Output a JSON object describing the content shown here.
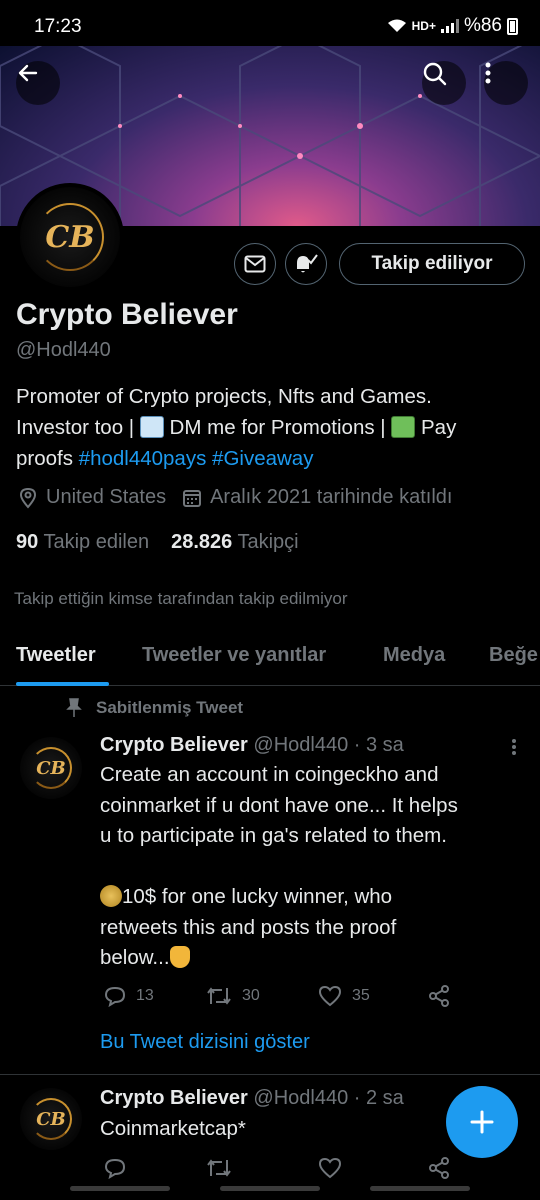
{
  "status_bar": {
    "time": "17:23",
    "network": "HD+",
    "battery": "%86"
  },
  "profile": {
    "name": "Crypto Believer",
    "handle": "@Hodl440",
    "avatar_monogram": "CB",
    "follow_button": "Takip ediliyor",
    "bio_line1": "Promoter of Crypto projects, Nfts and Games.",
    "bio_line2_a": "Investor too | ",
    "bio_line2_b": " DM me for Promotions | ",
    "bio_line2_c": " Pay",
    "bio_line3_a": "proofs ",
    "hashtag1": "#hodl440pays",
    "hashtag2": "#Giveaway",
    "location": "United States",
    "joined": "Aralık 2021 tarihinde katıldı",
    "following_count": "90",
    "following_label": "Takip edilen",
    "followers_count": "28.826",
    "followers_label": "Takipçi",
    "not_followed_notice": "Takip ettiğin kimse tarafından takip edilmiyor"
  },
  "tabs": [
    {
      "label": "Tweetler",
      "active": true
    },
    {
      "label": "Tweetler ve yanıtlar",
      "active": false
    },
    {
      "label": "Medya",
      "active": false
    },
    {
      "label": "Beğe",
      "active": false
    }
  ],
  "pinned_label": "Sabitlenmiş Tweet",
  "tweets": [
    {
      "author": "Crypto Believer",
      "handle_time": "@Hodl440 · 3 sa",
      "text_lines": [
        "Create an account in coingeckho and",
        "coinmarket if u dont have one... It helps",
        "u to participate in ga's related to them.",
        "",
        "10$ for one lucky winner, who",
        "retweets this and posts the proof",
        "below..."
      ],
      "replies": "13",
      "retweets": "30",
      "likes": "35",
      "show_thread": "Bu Tweet dizisini göster"
    },
    {
      "author": "Crypto Believer",
      "handle_time": "@Hodl440 · 2 sa",
      "text": "Coinmarketcap*"
    }
  ],
  "icons": {
    "back": "arrow-left-icon",
    "search": "search-icon",
    "more": "more-vertical-icon",
    "message": "envelope-icon",
    "notify": "bell-check-icon",
    "location": "location-pin-icon",
    "calendar": "calendar-icon",
    "pin": "pin-icon",
    "reply": "reply-icon",
    "retweet": "retweet-icon",
    "like": "heart-icon",
    "share": "share-icon",
    "compose": "plus-icon"
  },
  "colors": {
    "accent": "#1d9bf0",
    "text": "#e7e9ea",
    "muted": "#71767b",
    "border": "#2f3336"
  }
}
